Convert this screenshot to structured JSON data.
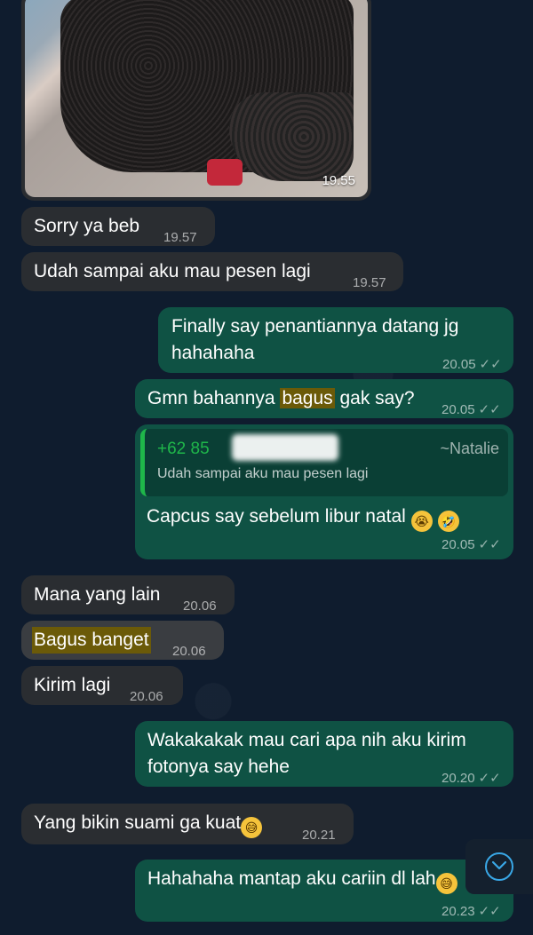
{
  "photo": {
    "time": "19.55"
  },
  "messages": [
    {
      "id": "m1",
      "dir": "in",
      "text": "Sorry ya beb",
      "time": "19.57"
    },
    {
      "id": "m2",
      "dir": "in",
      "text": "Udah sampai aku mau pesen lagi",
      "time": "19.57"
    },
    {
      "id": "m3",
      "dir": "out",
      "line1": "Finally say penantiannya datang jg",
      "line2": "hahahaha",
      "time": "20.05"
    },
    {
      "id": "m4",
      "dir": "out",
      "pre": "Gmn bahannya ",
      "highlight": "bagus",
      "post": " gak say?",
      "time": "20.05"
    },
    {
      "id": "m5",
      "dir": "out",
      "text": "Capcus say sebelum libur natal",
      "time": "20.05",
      "quote": {
        "sender": "+62 85",
        "name": "~Natalie",
        "text": "Udah sampai aku mau pesen lagi"
      }
    },
    {
      "id": "m6",
      "dir": "in",
      "text": "Mana yang lain",
      "time": "20.06"
    },
    {
      "id": "m7",
      "dir": "in",
      "highlight": "Bagus banget",
      "time": "20.06"
    },
    {
      "id": "m8",
      "dir": "in",
      "text": "Kirim lagi",
      "time": "20.06"
    },
    {
      "id": "m9",
      "dir": "out",
      "line1": "Wakakakak mau cari apa nih aku kirim",
      "line2": "fotonya say hehe",
      "time": "20.20"
    },
    {
      "id": "m10",
      "dir": "in",
      "text": "Yang bikin suami ga kuat",
      "time": "20.21"
    },
    {
      "id": "m11",
      "dir": "out",
      "text": "Hahahaha mantap aku cariin dl lah",
      "time": "20.23"
    }
  ],
  "ticks": "✓✓",
  "icons": {
    "scroll_down": "chevron-down-icon"
  },
  "colors": {
    "incoming": "#2a2d31",
    "outgoing": "#0f5244",
    "accent": "#1fb74a",
    "highlight": "#6b5a08"
  }
}
